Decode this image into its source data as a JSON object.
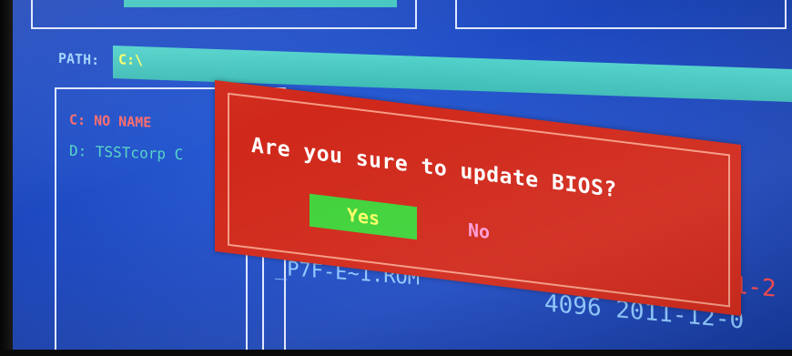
{
  "path": {
    "label": "PATH:",
    "value": "C:\\"
  },
  "drives": [
    {
      "label": "C: NO NAME"
    },
    {
      "label": "D: TSSTcorp C"
    }
  ],
  "dialog": {
    "question": "Are you sure to update BIOS?",
    "yes_label": "Yes",
    "no_label": "No"
  },
  "files": {
    "name": "_P7F-E~1.ROM",
    "size_and_date": "4096 2011-12-0",
    "right_date_fragment": "01-2"
  },
  "colors": {
    "screen_blue": "#1d48bf",
    "path_bar": "#42c6c0",
    "dialog_red": "#d0281a",
    "yes_green": "#3fd23a",
    "yes_text": "#ffff66",
    "no_text": "#ff9ad6"
  }
}
